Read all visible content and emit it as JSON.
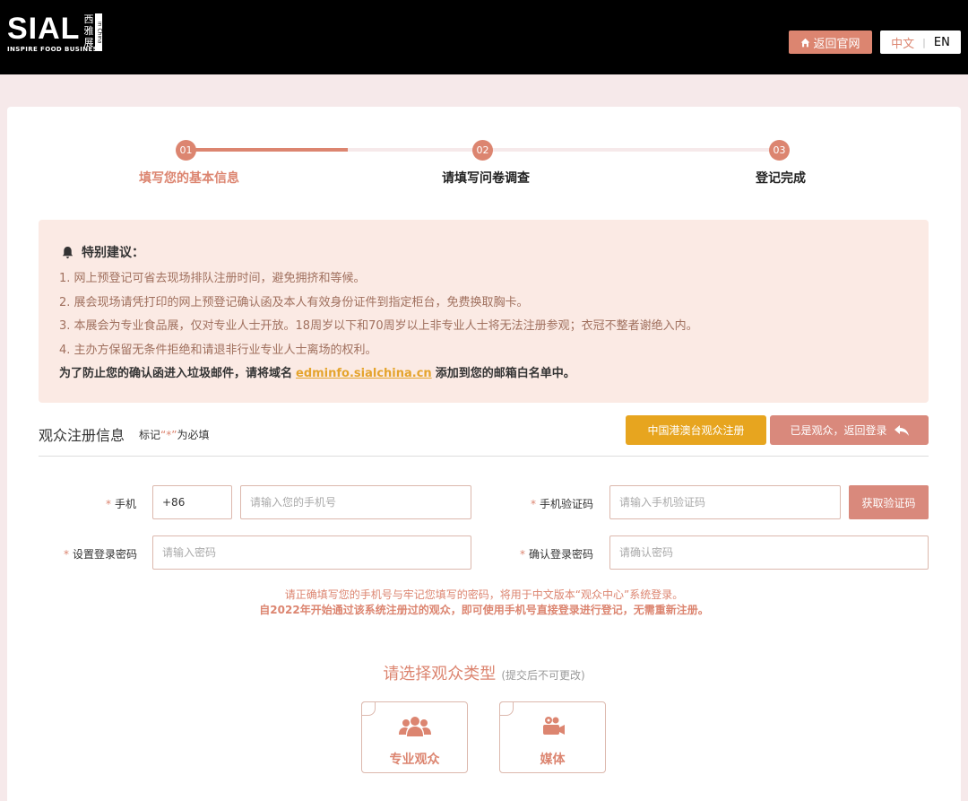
{
  "header": {
    "logo_word": "SIAL",
    "logo_tagline": "INSPIRE FOOD BUSINESS",
    "logo_cn": [
      "西",
      "雅",
      "展"
    ],
    "logo_side": "in China",
    "home_button": "返回官网",
    "lang_cn": "中文",
    "lang_sep": "|",
    "lang_en": "EN"
  },
  "steps": [
    {
      "num": "01",
      "label": "填写您的基本信息",
      "state": "active"
    },
    {
      "num": "02",
      "label": "请填写问卷调查",
      "state": "pending"
    },
    {
      "num": "03",
      "label": "登记完成",
      "state": "pending"
    }
  ],
  "notice": {
    "title": "特别建议：",
    "lines": [
      "1. 网上预登记可省去现场排队注册时间，避免拥挤和等候。",
      "2. 展会现场请凭打印的网上预登记确认函及本人有效身份证件到指定柜台，免费换取胸卡。",
      "3. 本展会为专业食品展，仅对专业人士开放。18周岁以下和70周岁以上非专业人士将无法注册参观；衣冠不整者谢绝入内。",
      "4. 主办方保留无条件拒绝和请退非行业专业人士离场的权利。"
    ],
    "last_before": "为了防止您的确认函进入垃圾邮件，请将域名",
    "last_domain": "edminfo.sialchina.cn",
    "last_after": "添加到您的邮箱白名单中。"
  },
  "section": {
    "title": "观众注册信息",
    "note_prefix": "标记",
    "note_star": "“*”",
    "note_suffix": "为必填",
    "hk_button": "中国港澳台观众注册",
    "login_button": "已是观众，返回登录"
  },
  "form": {
    "required_mark": "*",
    "phone_label": "手机",
    "phone_prefix": "+86",
    "phone_placeholder": "请输入您的手机号",
    "code_label": "手机验证码",
    "code_placeholder": "请输入手机验证码",
    "code_button": "获取验证码",
    "password_label": "设置登录密码",
    "password_placeholder": "请输入密码",
    "confirm_label": "确认登录密码",
    "confirm_placeholder": "请确认密码",
    "hint1": "请正确填写您的手机号与牢记您填写的密码，将用于中文版本“观众中心”系统登录。",
    "hint2": "自2022年开始通过该系统注册过的观众，即可使用手机号直接登录进行登记，无需重新注册。"
  },
  "visitor_type": {
    "title": "请选择观众类型",
    "subtitle": "(提交后不可更改)",
    "options": [
      {
        "label": "专业观众",
        "icon": "users-icon"
      },
      {
        "label": "媒体",
        "icon": "video-camera-icon"
      }
    ]
  },
  "colors": {
    "accent": "#dc8570",
    "gold": "#e7a51f",
    "notice_bg": "#fbeae4",
    "page_bg": "#f6e9ea"
  }
}
